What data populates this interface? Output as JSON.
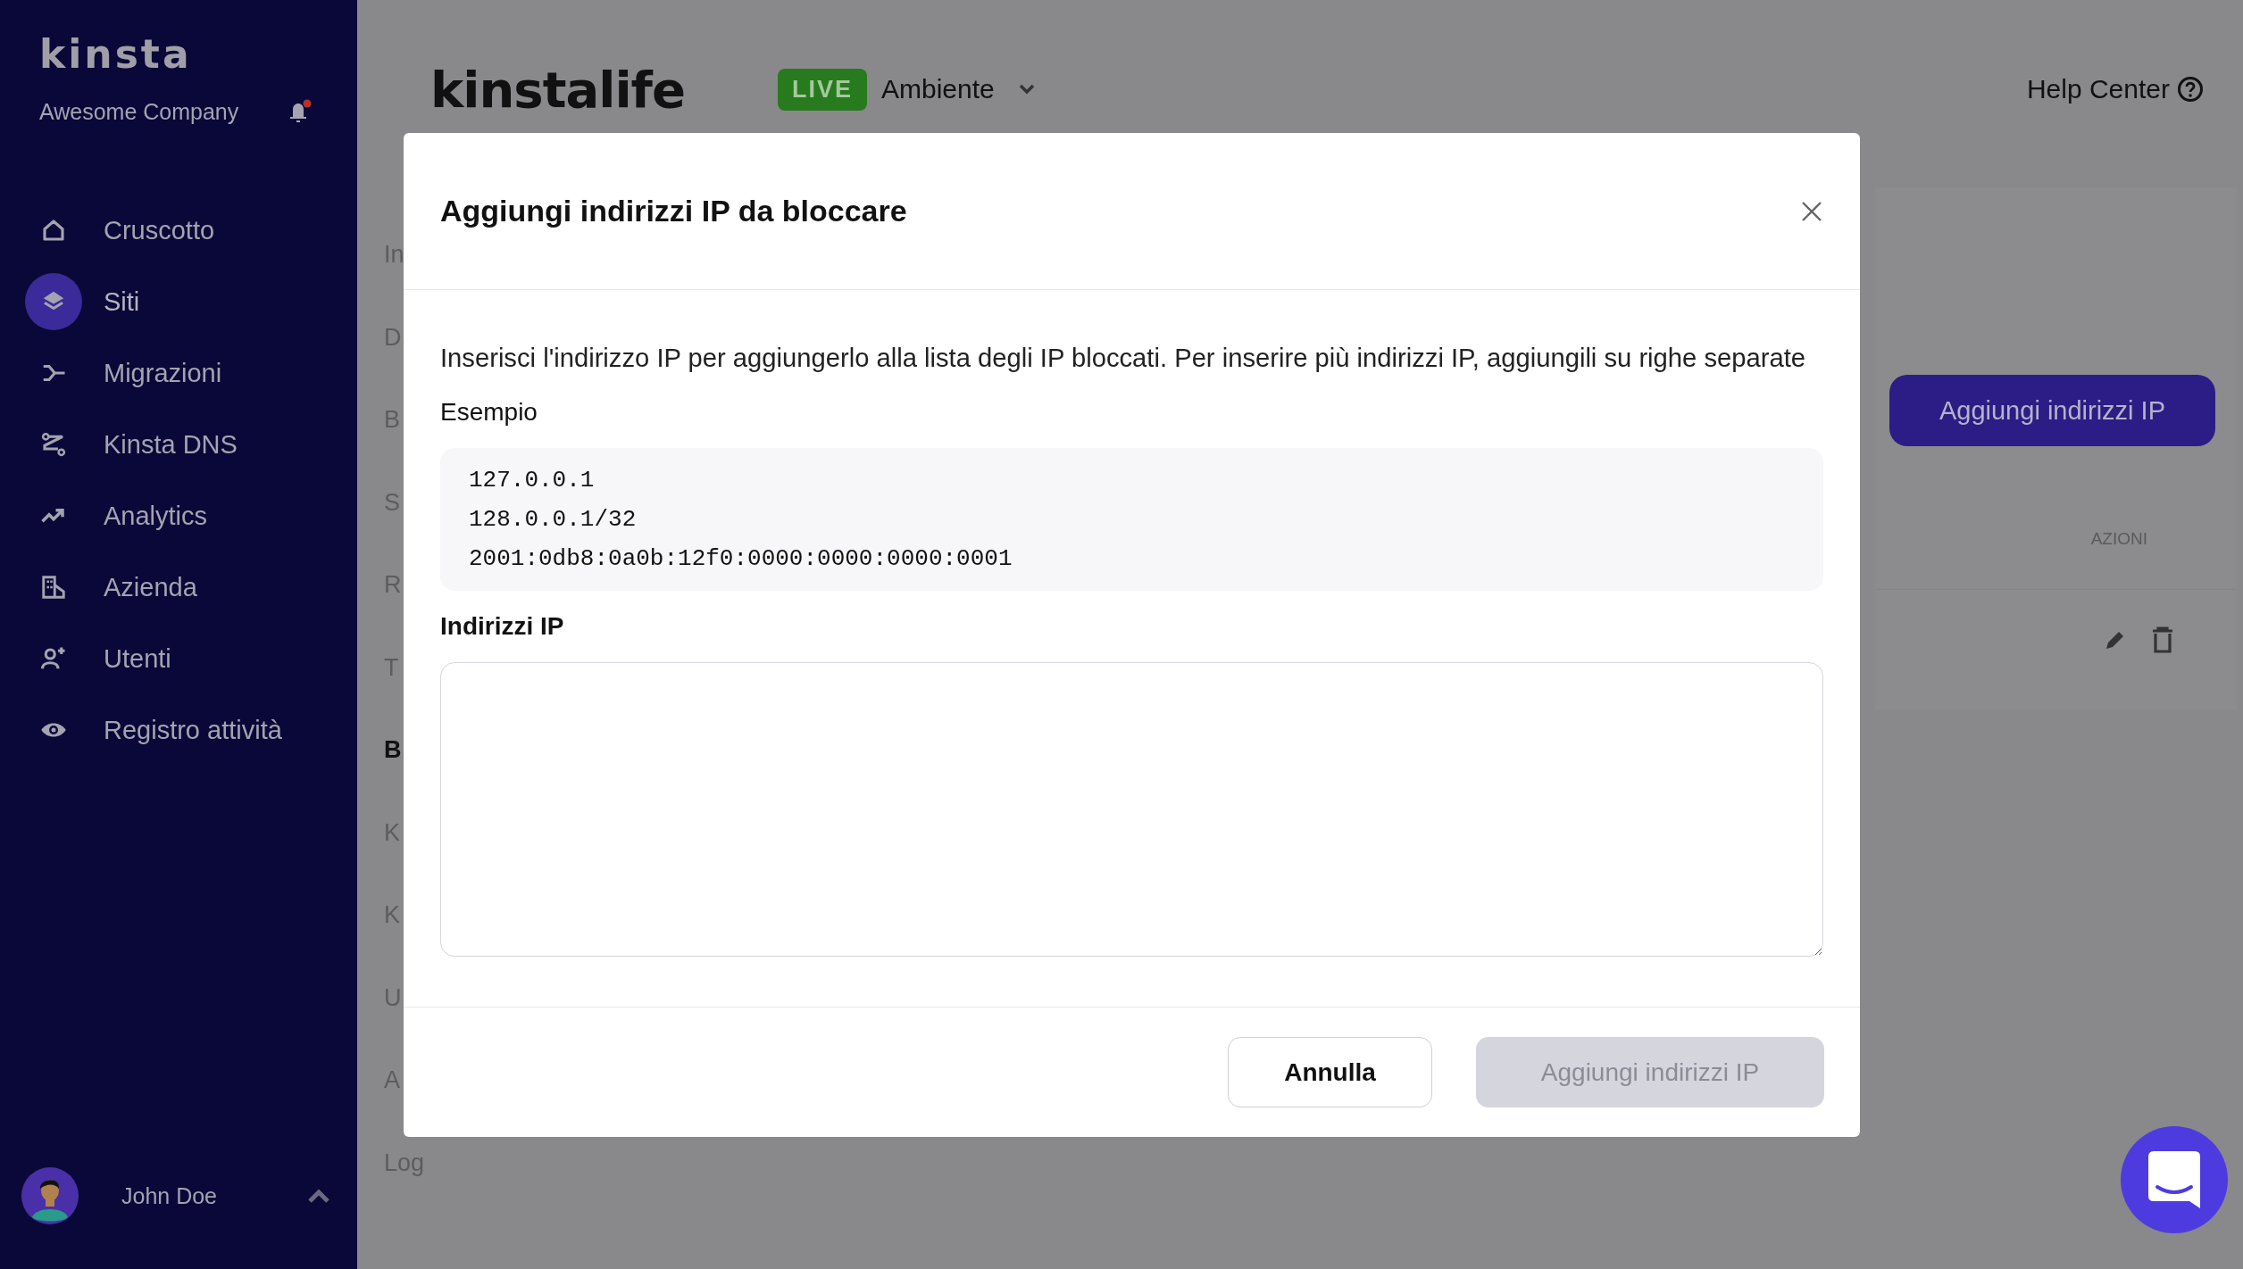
{
  "sidebar": {
    "logo": "kinsta",
    "company": "Awesome Company",
    "notifications_unread": true,
    "items": [
      {
        "label": "Cruscotto",
        "selected": false
      },
      {
        "label": "Siti",
        "selected": true
      },
      {
        "label": "Migrazioni",
        "selected": false
      },
      {
        "label": "Kinsta DNS",
        "selected": false
      },
      {
        "label": "Analytics",
        "selected": false
      },
      {
        "label": "Azienda",
        "selected": false
      },
      {
        "label": "Utenti",
        "selected": false
      },
      {
        "label": "Registro attività",
        "selected": false
      }
    ],
    "user": {
      "name": "John Doe"
    }
  },
  "header": {
    "site_name": "kinstalife",
    "environment_badge": "LIVE",
    "environment": "Ambiente",
    "help": "Help Center"
  },
  "page": {
    "nav_fragments": [
      {
        "text": "In",
        "bold": false
      },
      {
        "text": "D",
        "bold": false
      },
      {
        "text": "B",
        "bold": false
      },
      {
        "text": "S",
        "bold": false
      },
      {
        "text": "R",
        "bold": false
      },
      {
        "text": "T",
        "bold": false
      },
      {
        "text": "B",
        "bold": true
      },
      {
        "text": "K",
        "bold": false
      },
      {
        "text": "K",
        "bold": false
      },
      {
        "text": "U",
        "bold": false
      },
      {
        "text": "A",
        "bold": false
      },
      {
        "text": "Log",
        "bold": false
      }
    ],
    "add_button": "Aggiungi indirizzi IP",
    "actions_header": "AZIONI"
  },
  "modal": {
    "title": "Aggiungi indirizzi IP da bloccare",
    "description": "Inserisci l'indirizzo IP per aggiungerlo alla lista degli IP bloccati. Per inserire più indirizzi IP, aggiungili su righe separate",
    "example_label": "Esempio",
    "example_lines": [
      "127.0.0.1",
      "128.0.0.1/32",
      "2001:0db8:0a0b:12f0:0000:0000:0000:0001"
    ],
    "field_label": "Indirizzi IP",
    "buttons": [
      {
        "label": "Annulla",
        "kind": "secondary",
        "disabled": false
      },
      {
        "label": "Aggiungi indirizzi IP",
        "kind": "primary",
        "disabled": true
      }
    ]
  }
}
